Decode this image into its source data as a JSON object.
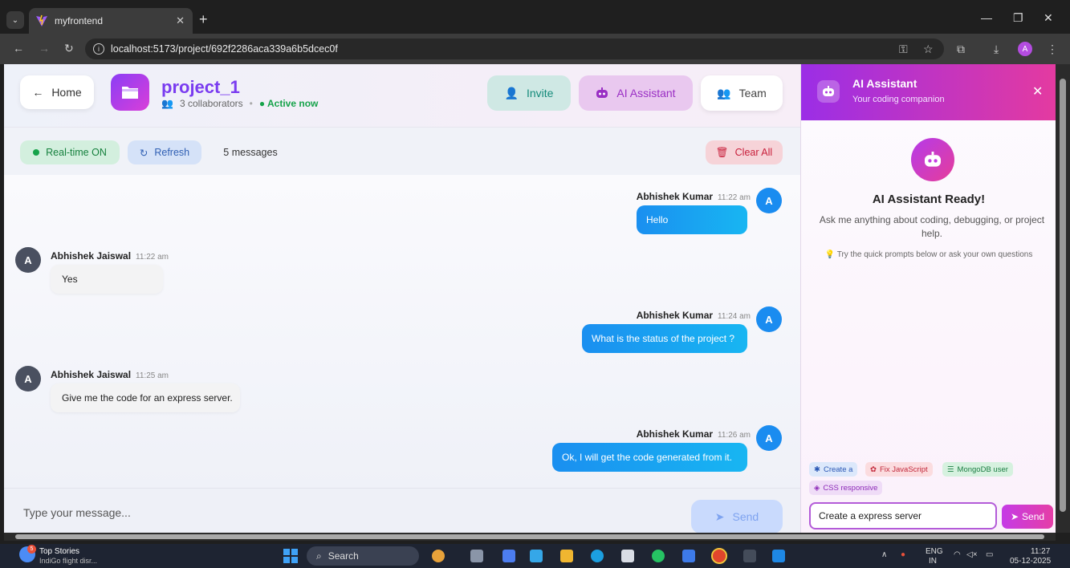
{
  "browser": {
    "tab_title": "myfrontend",
    "url": "localhost:5173/project/692f2286aca339a6b5dcec0f"
  },
  "header": {
    "home_label": "Home",
    "project_name": "project_1",
    "collaborators": "3 collaborators",
    "separator": "•",
    "status": "Active now",
    "invite_label": "Invite",
    "ai_label": "AI Assistant",
    "team_label": "Team"
  },
  "toolbar": {
    "realtime_label": "Real-time ON",
    "refresh_label": "Refresh",
    "message_count": "5 messages",
    "clear_label": "Clear All"
  },
  "messages": [
    {
      "sender": "Abhishek Kumar",
      "time": "11:22 am",
      "text": "Hello",
      "outgoing": true,
      "avatar": "A"
    },
    {
      "sender": "Abhishek Jaiswal",
      "time": "11:22 am",
      "text": "Yes",
      "outgoing": false,
      "avatar": "A"
    },
    {
      "sender": "Abhishek Kumar",
      "time": "11:24 am",
      "text": "What is the status of the project ?",
      "outgoing": true,
      "avatar": "A"
    },
    {
      "sender": "Abhishek Jaiswal",
      "time": "11:25 am",
      "text": "Give me the code for an express server.",
      "outgoing": false,
      "avatar": "A"
    },
    {
      "sender": "Abhishek Kumar",
      "time": "11:26 am",
      "text": "Ok, I will get the code generated from it.",
      "outgoing": true,
      "avatar": "A"
    }
  ],
  "composer": {
    "placeholder": "Type your message...",
    "send_label": "Send"
  },
  "ai_panel": {
    "title": "AI Assistant",
    "subtitle": "Your coding companion",
    "ready_title": "AI Assistant Ready!",
    "description": "Ask me anything about coding, debugging, or project help.",
    "tip": "Try the quick prompts below or ask your own questions",
    "chips": [
      "Create a",
      "Fix JavaScript",
      "MongoDB user",
      "CSS responsive"
    ],
    "input_value": "Create a express server",
    "send_label": "Send"
  },
  "taskbar": {
    "news_title": "Top Stories",
    "news_sub": "IndiGo flight disr...",
    "news_badge": "5",
    "search_label": "Search",
    "lang_top": "ENG",
    "lang_bottom": "IN",
    "time": "11:27",
    "date": "05-12-2025"
  },
  "colors": {
    "accent_purple": "#7a3cf0",
    "outgoing_bubble": "#1a8ff0",
    "ai_gradient_start": "#9b2ee6",
    "ai_gradient_end": "#e43aa0",
    "active_green": "#16a34a",
    "clear_red": "#c81e3a"
  },
  "icons": [
    "robot-icon",
    "folder-icon",
    "user-plus-icon",
    "team-icon",
    "refresh-icon",
    "trash-icon",
    "send-icon",
    "close-icon",
    "back-arrow-icon",
    "lightbulb-icon"
  ]
}
